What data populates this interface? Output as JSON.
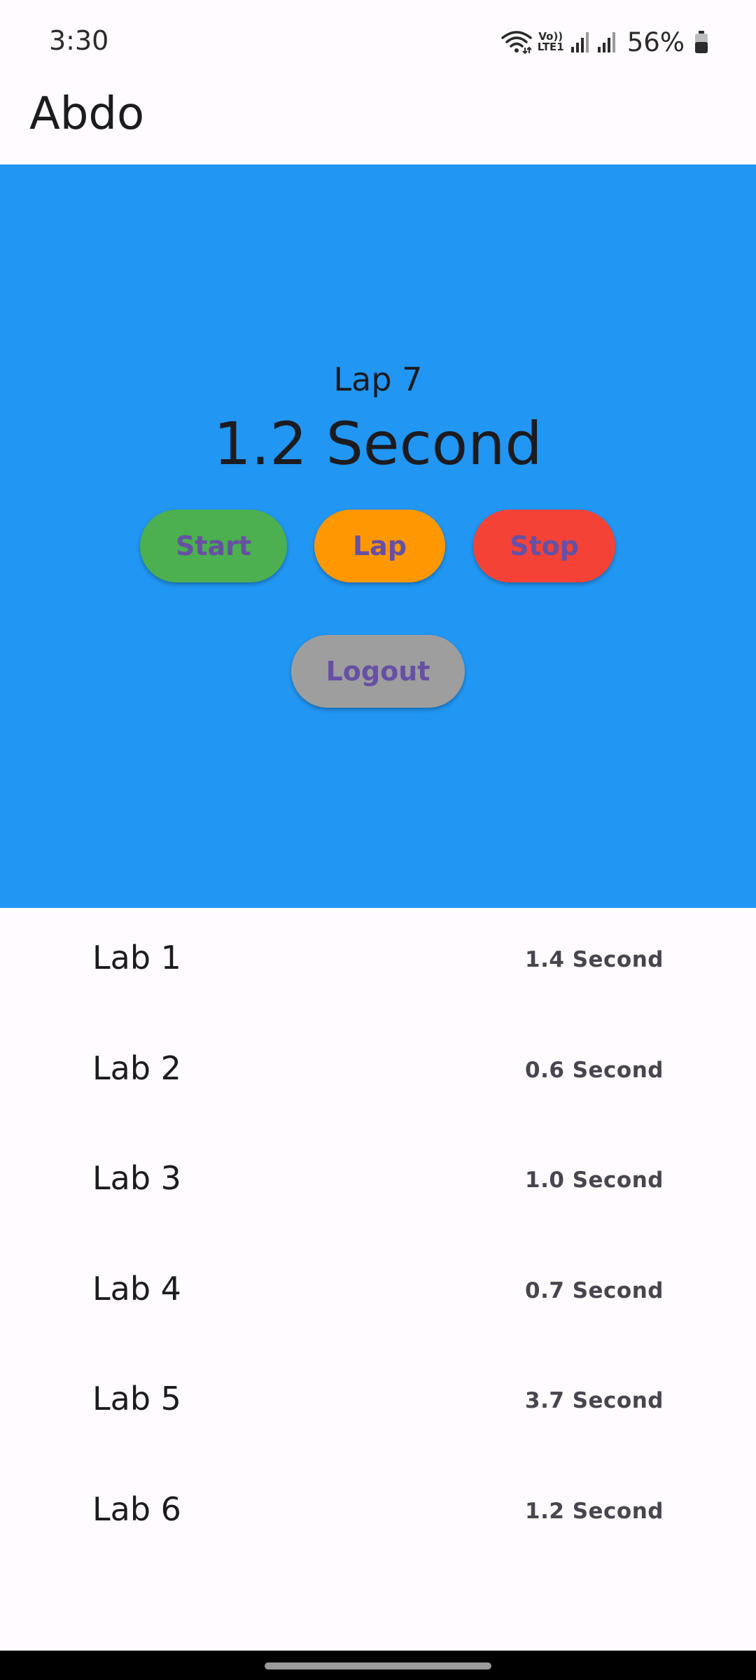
{
  "status_bar": {
    "time": "3:30",
    "volte_line1": "Vo))",
    "volte_line2": "LTE1",
    "battery_percent": "56%",
    "icons": [
      "wifi-icon",
      "volte-icon",
      "signal-icon",
      "signal-icon",
      "battery-icon"
    ]
  },
  "app_bar": {
    "title": "Abdo"
  },
  "stopwatch": {
    "current_lap_label": "Lap 7",
    "current_time": "1.2 Second",
    "background_color": "#2196f3"
  },
  "buttons": {
    "start": "Start",
    "lap": "Lap",
    "stop": "Stop",
    "logout": "Logout",
    "colors": {
      "start": "#4caf50",
      "lap": "#ff9800",
      "stop": "#f44336",
      "logout": "#9e9e9e",
      "label": "#6750a4"
    }
  },
  "laps": [
    {
      "name": "Lab 1",
      "time": "1.4 Second"
    },
    {
      "name": "Lab 2",
      "time": "0.6 Second"
    },
    {
      "name": "Lab 3",
      "time": "1.0 Second"
    },
    {
      "name": "Lab 4",
      "time": "0.7 Second"
    },
    {
      "name": "Lab 5",
      "time": "3.7 Second"
    },
    {
      "name": "Lab 6",
      "time": "1.2 Second"
    }
  ]
}
